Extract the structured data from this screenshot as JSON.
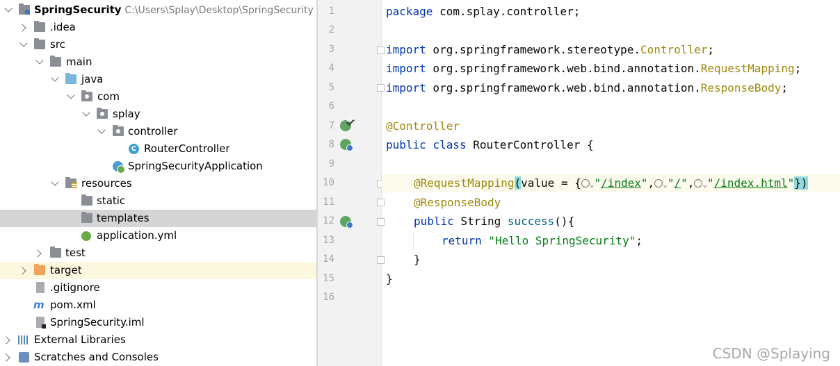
{
  "tree": {
    "project_name": "SpringSecurity",
    "project_path": "C:\\Users\\Splay\\Desktop\\SpringSecurity",
    "items": [
      {
        "label": ".idea"
      },
      {
        "label": "src"
      },
      {
        "label": "main"
      },
      {
        "label": "java"
      },
      {
        "label": "com"
      },
      {
        "label": "splay"
      },
      {
        "label": "controller"
      },
      {
        "label": "RouterController",
        "icon_letter": "C"
      },
      {
        "label": "SpringSecurityApplication"
      },
      {
        "label": "resources"
      },
      {
        "label": "static"
      },
      {
        "label": "templates"
      },
      {
        "label": "application.yml"
      },
      {
        "label": "test"
      },
      {
        "label": "target"
      },
      {
        "label": ".gitignore"
      },
      {
        "label": "pom.xml",
        "icon_letter": "m"
      },
      {
        "label": "SpringSecurity.iml"
      },
      {
        "label": "External Libraries"
      },
      {
        "label": "Scratches and Consoles"
      }
    ]
  },
  "editor": {
    "line_numbers": [
      "1",
      "2",
      "3",
      "4",
      "5",
      "6",
      "7",
      "8",
      "9",
      "10",
      "11",
      "12",
      "13",
      "14",
      "15",
      "16"
    ],
    "code": {
      "l1_kw": "package",
      "l1_rest": " com.splay.controller;",
      "import_kw": "import",
      "l3_pkg": " org.springframework.stereotype.",
      "l3_cls": "Controller",
      "l3_end": ";",
      "l4_pkg": " org.springframework.web.bind.annotation.",
      "l4_cls": "RequestMapping",
      "l4_end": ";",
      "l5_pkg": " org.springframework.web.bind.annotation.",
      "l5_cls": "ResponseBody",
      "l5_end": ";",
      "l7_ann": "@Controller",
      "l8_kw": "public class",
      "l8_rest": " RouterController {",
      "l10_ann": "@RequestMapping",
      "l10_open": "(",
      "l10_value": "value = {",
      "l10_s1": "/index",
      "l10_s2": "/",
      "l10_s3": "/index.html",
      "l10_close": "})",
      "quote": "\"",
      "comma": ",",
      "l11_ann": "@ResponseBody",
      "l12_kw": "public",
      "l12_type": " String ",
      "l12_fn": "success",
      "l12_rest": "(){",
      "l13_kw": "return",
      "l13_str": " \"Hello SpringSecurity\"",
      "l13_end": ";",
      "l14": "}",
      "l15": "}"
    }
  },
  "watermark": "CSDN @Splaying",
  "colors": {
    "keyword": "#0033b3",
    "annotation": "#9e880d",
    "string": "#067d17",
    "function": "#00627a"
  }
}
